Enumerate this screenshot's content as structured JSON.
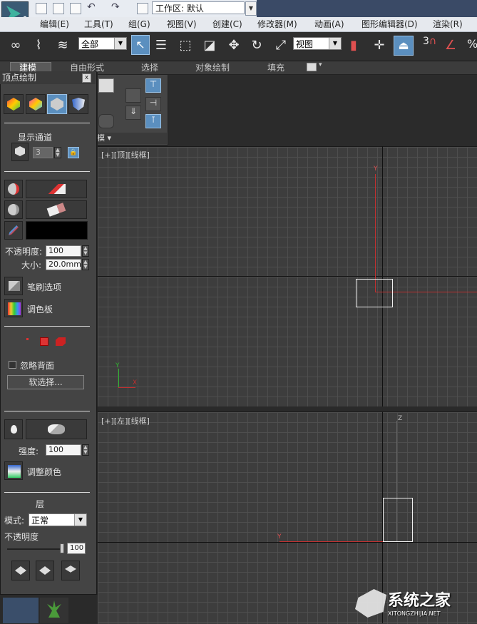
{
  "titlebar": {
    "workspace_label": "工作区: 默认"
  },
  "menubar": {
    "items": [
      "编辑(E)",
      "工具(T)",
      "组(G)",
      "视图(V)",
      "创建(C)",
      "修改器(M)",
      "动画(A)",
      "图形编辑器(D)",
      "渲染(R)"
    ]
  },
  "toolbar": {
    "selection_filter": "全部",
    "coord_system": "视图",
    "snap_label": "3",
    "percent_label": "%"
  },
  "ribbon": {
    "tabs": [
      "建模",
      "自由形式",
      "选择",
      "对象绘制",
      "填充"
    ],
    "panel_strip_label": "模 ▾"
  },
  "viewports": {
    "top_label": "[+][顶][线框]",
    "left_label": "[+][左][线框]",
    "axis_y": "Y",
    "axis_x": "X",
    "axis_z": "Z"
  },
  "vertex_paint": {
    "title": "顶点绘制",
    "close": "x",
    "channel_label": "显示通道",
    "channel_value": "3",
    "opacity_label": "不透明度:",
    "opacity_value": "100",
    "size_label": "大小:",
    "size_value": "20.0mm",
    "brush_options": "笔刷选项",
    "palette": "调色板",
    "ignore_backface": "忽略背面",
    "soft_select": "软选择...",
    "strength_label": "强度:",
    "strength_value": "100",
    "adjust_color": "调整颜色",
    "layer_title": "层",
    "mode_label": "模式:",
    "mode_value": "正常",
    "layer_opacity_label": "不透明度",
    "layer_opacity_value": "100",
    "paint_color": "#000000",
    "opacity_slider_level": 1.0
  },
  "watermark": {
    "brand": "系统之家",
    "url": "XITONGZHIJIA.NET"
  }
}
